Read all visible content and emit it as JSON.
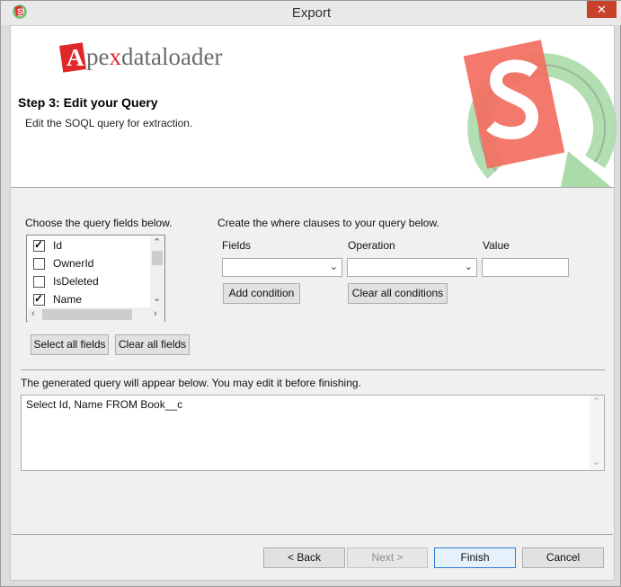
{
  "window": {
    "title": "Export",
    "close_label": "✕"
  },
  "header": {
    "brand_letter": "A",
    "brand_pe": "pe",
    "brand_x": "x",
    "brand_rest": "dataloader",
    "step_title": "Step 3: Edit your Query",
    "step_desc": "Edit the SOQL query for extraction."
  },
  "fields_panel": {
    "label": "Choose the query fields below.",
    "items": [
      {
        "label": "Id",
        "checked": true
      },
      {
        "label": "OwnerId",
        "checked": false
      },
      {
        "label": "IsDeleted",
        "checked": false
      },
      {
        "label": "Name",
        "checked": true
      }
    ],
    "select_all_label": "Select all fields",
    "clear_all_label": "Clear all fields"
  },
  "where_panel": {
    "label": "Create the where clauses to your query below.",
    "fields_label": "Fields",
    "operation_label": "Operation",
    "value_label": "Value",
    "fields_value": "",
    "operation_value": "",
    "value_value": "",
    "add_condition_label": "Add condition",
    "clear_conditions_label": "Clear all conditions"
  },
  "query_panel": {
    "label": "The generated query will appear below.  You may edit it before finishing.",
    "query_text": "Select Id, Name FROM Book__c"
  },
  "footer": {
    "back_label": "< Back",
    "next_label": "Next >",
    "finish_label": "Finish",
    "cancel_label": "Cancel"
  },
  "colors": {
    "brand_red": "#e0282a",
    "logo_green": "#9bd39b",
    "logo_salmon": "#f36e61"
  }
}
